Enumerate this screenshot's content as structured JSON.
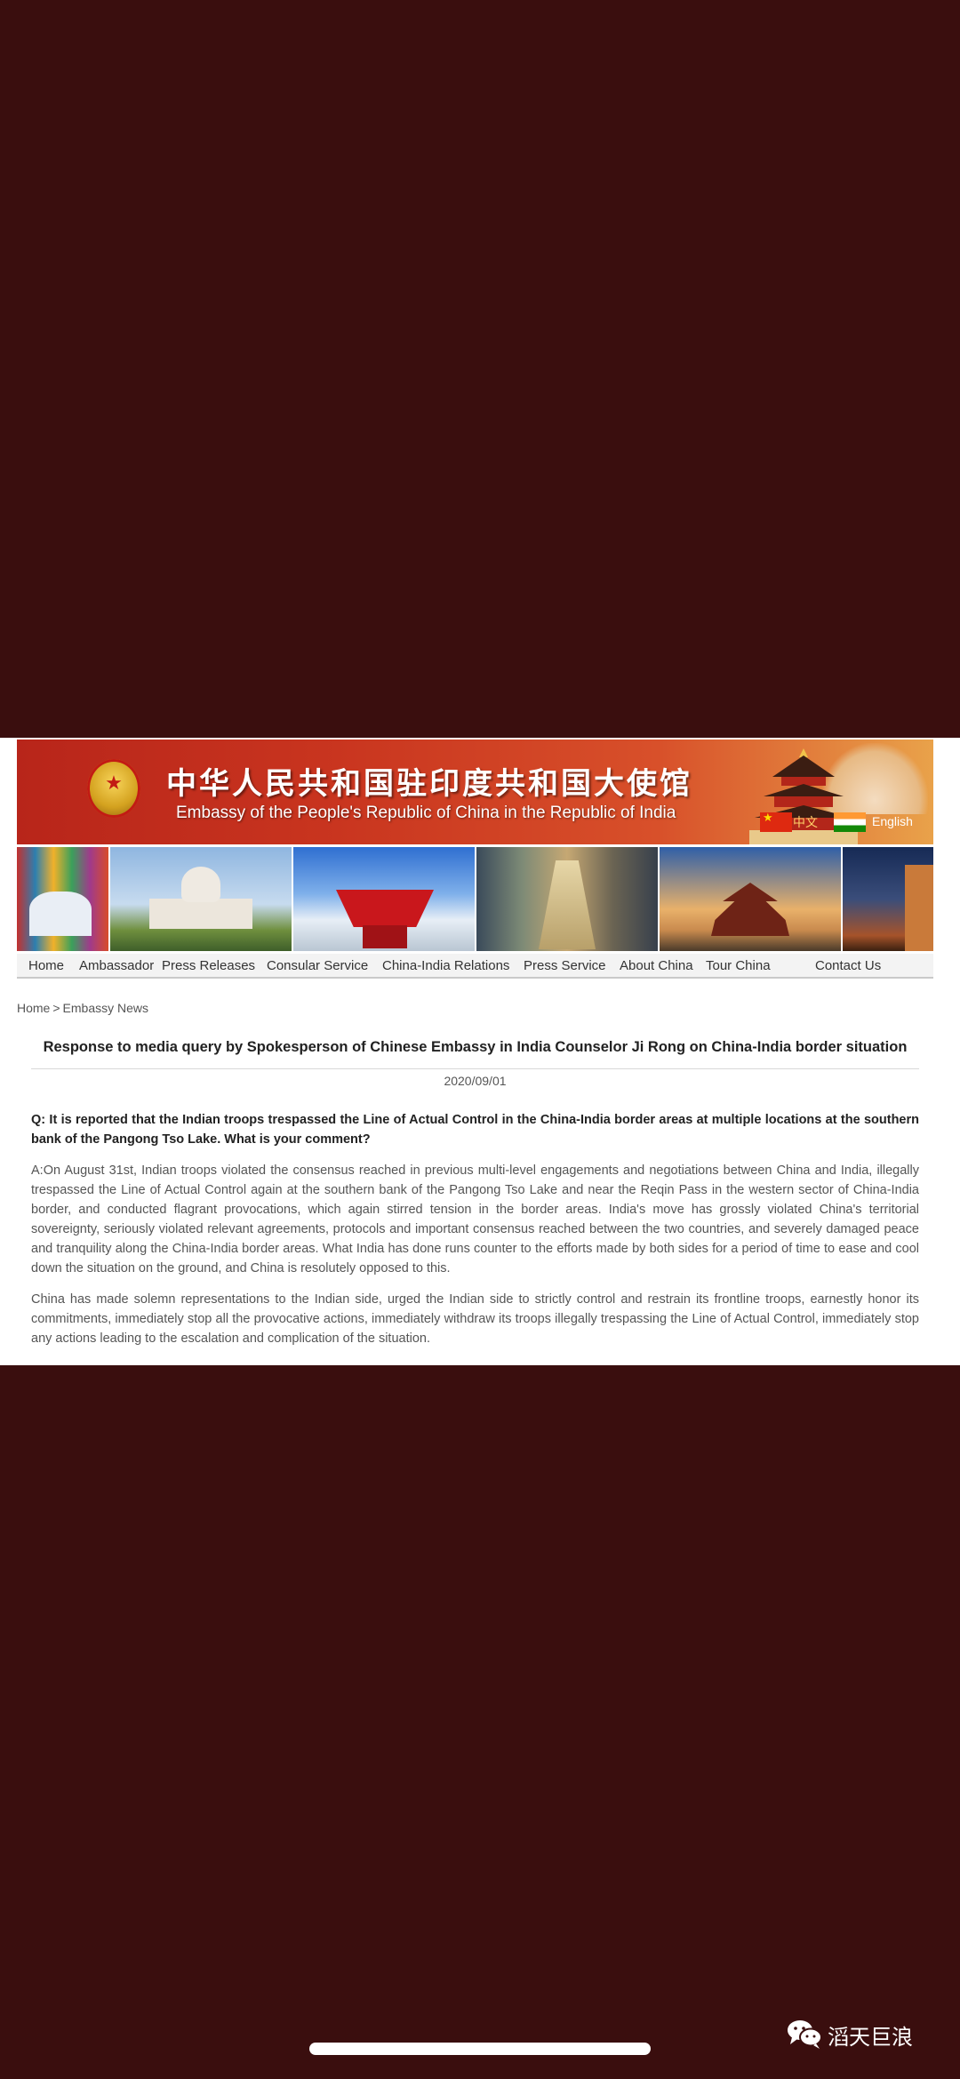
{
  "banner": {
    "emblem_symbol": "★",
    "title_cn": "中华人民共和国驻印度共和国大使馆",
    "title_en": "Embassy of the People's Republic of China in the Republic of India",
    "lang_cn": "中文",
    "lang_en": "English"
  },
  "nav": {
    "items": [
      "Home",
      "Ambassador",
      "Press Releases",
      "Consular Service",
      "China-India Relations",
      "Press Service",
      "About China",
      "Tour China",
      "Contact Us"
    ]
  },
  "breadcrumb": {
    "home": "Home",
    "separator": ">",
    "section": "Embassy News"
  },
  "article": {
    "title": "Response to media query by Spokesperson of Chinese Embassy in India Counselor Ji Rong on China-India border situation",
    "date": "2020/09/01",
    "question": "Q: It is reported that the Indian troops trespassed the Line of Actual Control in the China-India border areas at multiple locations at the southern bank of the Pangong Tso Lake. What is your comment?",
    "paragraphs": [
      "A:On August 31st, Indian troops violated the consensus reached in previous multi-level engagements and negotiations between China and India, illegally trespassed the Line of Actual Control again at the southern bank of the Pangong Tso Lake and near the Reqin Pass in the western sector of China-India border, and conducted flagrant provocations, which again stirred tension in the border areas. India's move has grossly violated China's territorial sovereignty, seriously violated relevant agreements, protocols and important consensus reached between the two countries, and severely damaged peace and tranquility along the China-India border areas. What India has done runs counter to the efforts made by both sides for a period of time to ease and cool down the situation on the ground, and China is resolutely opposed to this.",
      "China has made solemn representations to the Indian side, urged the Indian side to strictly control and restrain its frontline troops, earnestly honor its commitments, immediately stop all the provocative actions, immediately withdraw its troops illegally trespassing the Line of Actual Control, immediately stop any actions leading to the escalation and complication of the situation."
    ]
  },
  "watermark": {
    "icon": "wechat-icon",
    "text": "滔天巨浪"
  },
  "colors": {
    "backdrop": "#3a0e0e",
    "banner_red": "#c9351f",
    "text_dark": "#222222",
    "text_body": "#555555"
  }
}
